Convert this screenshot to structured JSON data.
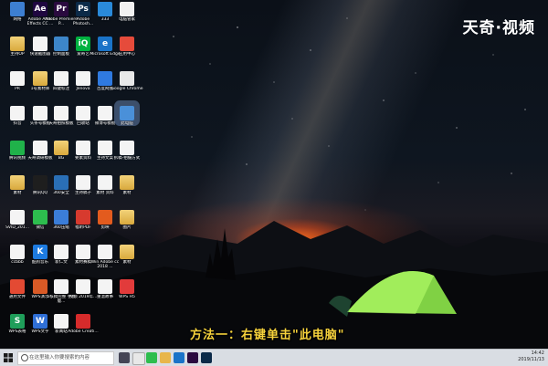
{
  "watermark": "天奇·视频",
  "subtitle": "方法一：右键单击\"此电脑\"",
  "search": {
    "placeholder": "在这里输入你要搜索的内容"
  },
  "tray": {
    "time": "14:42",
    "date": "2019/11/13"
  },
  "desktop_icons": [
    {
      "label": "网络",
      "icon": "network-icon",
      "color": "#3d7fd1"
    },
    {
      "label": "Adobe After Effects CC ...",
      "icon": "ae-icon",
      "color": "#1f0740",
      "glyph": "Ae"
    },
    {
      "label": "Adobe Premiere P...",
      "icon": "pr-icon",
      "color": "#2a0a3f",
      "glyph": "Pr"
    },
    {
      "label": "Adobe Photosh...",
      "icon": "ps-icon",
      "color": "#0b2a48",
      "glyph": "Ps"
    },
    {
      "label": "333",
      "icon": "shield-icon",
      "color": "#2a8ad9"
    },
    {
      "label": "电脑管家",
      "icon": "file-icon",
      "color": "#f1f1f1"
    },
    {
      "label": "主持OP",
      "icon": "folder-icon"
    },
    {
      "label": "快速截图器",
      "icon": "file-icon"
    },
    {
      "label": "控制面板",
      "icon": "control-panel-icon",
      "color": "#3d86c9"
    },
    {
      "label": "爱奇艺",
      "icon": "iqiyi-icon",
      "color": "#00b140",
      "glyph": "iQ"
    },
    {
      "label": "Microsoft Edge",
      "icon": "edge-icon",
      "color": "#1a73c8",
      "glyph": "e"
    },
    {
      "label": "应用中心",
      "icon": "app-center-icon",
      "color": "#e64b3b"
    },
    {
      "label": "PR",
      "icon": "file-icon"
    },
    {
      "label": "1号素材库",
      "icon": "folder-icon"
    },
    {
      "label": "四键标注",
      "icon": "file-icon"
    },
    {
      "label": "Jenova",
      "icon": "file-icon"
    },
    {
      "label": "百度网盘",
      "icon": "baidu-pan-icon",
      "color": "#2f7ae0"
    },
    {
      "label": "Google Chrome",
      "icon": "chrome-icon",
      "color": "#e8e8e8"
    },
    {
      "label": "抖音",
      "icon": "file-icon"
    },
    {
      "label": "头条号模板",
      "icon": "file-icon"
    },
    {
      "label": "天奇拍照模板",
      "icon": "file-icon"
    },
    {
      "label": "回收站",
      "icon": "recycle-bin-icon"
    },
    {
      "label": "微博号模板",
      "icon": "file-icon"
    },
    {
      "label": "此电脑",
      "icon": "this-pc-icon",
      "color": "#4a90d9"
    },
    {
      "label": "腾讯视频",
      "icon": "tencent-video-icon",
      "color": "#20b24a"
    },
    {
      "label": "天奇调研模板",
      "icon": "file-icon"
    },
    {
      "label": "BG",
      "icon": "folder-icon"
    },
    {
      "label": "要素资料",
      "icon": "file-icon"
    },
    {
      "label": "主持文案",
      "icon": "file-icon"
    },
    {
      "label": "拆稿-拍摄方式",
      "icon": "file-icon"
    },
    {
      "label": "素材",
      "icon": "folder-icon"
    },
    {
      "label": "腾讯QQ",
      "icon": "qq-icon",
      "color": "#1e1e1e"
    },
    {
      "label": "360安全",
      "icon": "file-icon",
      "color": "#2a6fb6"
    },
    {
      "label": "主持稿子",
      "icon": "file-icon"
    },
    {
      "label": "素材 资料",
      "icon": "file-icon"
    },
    {
      "label": "素材",
      "icon": "folder-icon"
    },
    {
      "label": "SVID_201...",
      "icon": "file-icon"
    },
    {
      "label": "微信",
      "icon": "wechat-icon",
      "color": "#2dbd4e"
    },
    {
      "label": "360压缩",
      "icon": "file-icon",
      "color": "#3b7dd8"
    },
    {
      "label": "福昕PDF",
      "icon": "pdf-icon",
      "color": "#d73a2e"
    },
    {
      "label": "剪映",
      "icon": "file-icon",
      "color": "#e35b1e"
    },
    {
      "label": "图片",
      "icon": "folder-icon"
    },
    {
      "label": "ccbbb",
      "icon": "file-icon"
    },
    {
      "label": "酷狗音乐",
      "icon": "kugou-icon",
      "color": "#1d7be0",
      "glyph": "K"
    },
    {
      "label": "新仁文",
      "icon": "file-icon"
    },
    {
      "label": "素材赛稿",
      "icon": "file-icon"
    },
    {
      "label": "Win Adobe cc 2018 ...",
      "icon": "file-icon"
    },
    {
      "label": "素材",
      "icon": "folder-icon"
    },
    {
      "label": "通用文件",
      "icon": "file-icon",
      "color": "#e34a33"
    },
    {
      "label": "WPS演示",
      "icon": "wps-presentation-icon",
      "color": "#d95a26"
    },
    {
      "label": "5核稿完整 手机版...",
      "icon": "file-icon"
    },
    {
      "label": "视频 2019年...",
      "icon": "file-icon"
    },
    {
      "label": "重温故事",
      "icon": "file-icon"
    },
    {
      "label": "WPS H5",
      "icon": "wps-h5-icon",
      "color": "#e23b3b"
    },
    {
      "label": "WPS表格",
      "icon": "wps-sheet-icon",
      "color": "#1f9e5a",
      "glyph": "S"
    },
    {
      "label": "WPS文字",
      "icon": "wps-writer-icon",
      "color": "#2f6fd6",
      "glyph": "W"
    },
    {
      "label": "新闻站",
      "icon": "file-icon"
    },
    {
      "label": "Adobe Creati...",
      "icon": "adobe-cc-icon",
      "color": "#d62b2b"
    }
  ]
}
